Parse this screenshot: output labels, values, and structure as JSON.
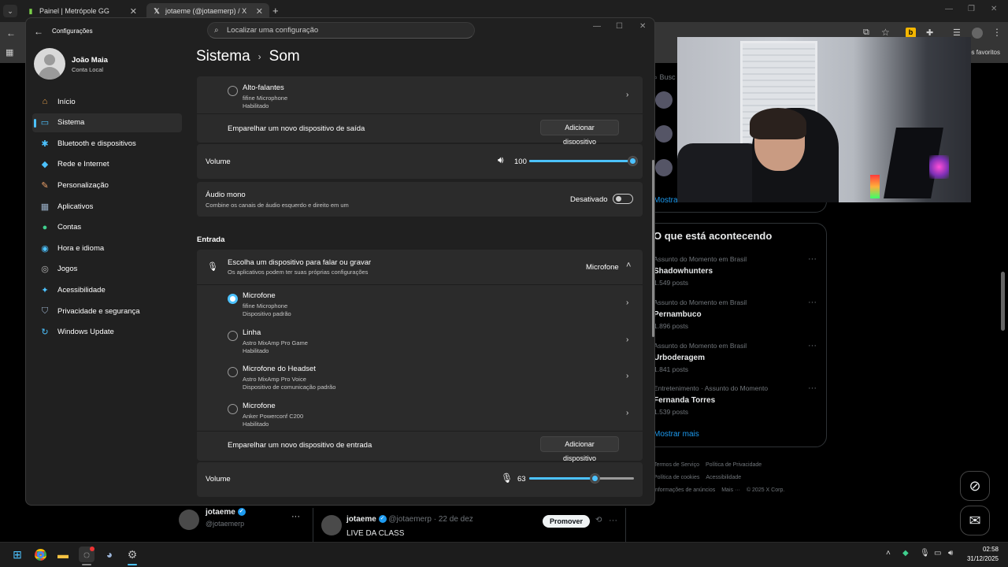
{
  "browser": {
    "tabs": [
      {
        "label": "Painel | Metrópole GG",
        "active": false
      },
      {
        "label": "jotaeme (@jotaemerp) / X",
        "active": true
      }
    ],
    "favorites_label": "os favoritos"
  },
  "x_page": {
    "search_placeholder": "Busc",
    "show_more_top": "Mostrar mais",
    "trends_title": "O que está acontecendo",
    "trends": [
      {
        "category": "Assunto do Momento em Brasil",
        "name": "Shadowhunters",
        "posts": "1.549 posts"
      },
      {
        "category": "Assunto do Momento em Brasil",
        "name": "Pernambuco",
        "posts": "1.896 posts"
      },
      {
        "category": "Assunto do Momento em Brasil",
        "name": "Urboderagem",
        "posts": "1.841 posts"
      },
      {
        "category": "Entretenimento · Assunto do Momento",
        "name": "Fernanda Torres",
        "posts": "1.539 posts"
      }
    ],
    "show_more": "Mostrar mais",
    "footer": [
      "Termos de Serviço",
      "Política de Privacidade",
      "Política de cookies",
      "Acessibilidade",
      "Informações de anúncios",
      "Mais ···",
      "© 2025 X Corp."
    ],
    "profile_card": {
      "name": "jotaeme",
      "handle": "@jotaemerp"
    },
    "tweet": {
      "name": "jotaeme",
      "handle": "@jotaemerp",
      "date": "· 22 de dez",
      "text": "LIVE DA CLASS",
      "promote": "Promover"
    }
  },
  "settings": {
    "title": "Configurações",
    "search_placeholder": "Localizar uma configuração",
    "user": {
      "name": "João Maia",
      "account": "Conta Local"
    },
    "nav": [
      {
        "label": "Início",
        "icon": "home-icon",
        "glyph": "⌂",
        "color": "#e8a04a"
      },
      {
        "label": "Sistema",
        "icon": "system-icon",
        "glyph": "▭",
        "color": "#4cc2ff",
        "active": true
      },
      {
        "label": "Bluetooth e dispositivos",
        "icon": "bluetooth-icon",
        "glyph": "✱",
        "color": "#4cc2ff"
      },
      {
        "label": "Rede e Internet",
        "icon": "wifi-icon",
        "glyph": "◆",
        "color": "#4cc2ff"
      },
      {
        "label": "Personalização",
        "icon": "brush-icon",
        "glyph": "✎",
        "color": "#f0a36a"
      },
      {
        "label": "Aplicativos",
        "icon": "apps-icon",
        "glyph": "▦",
        "color": "#9ab0c8"
      },
      {
        "label": "Contas",
        "icon": "accounts-icon",
        "glyph": "●",
        "color": "#3fcf8e"
      },
      {
        "label": "Hora e idioma",
        "icon": "globe-icon",
        "glyph": "◉",
        "color": "#4cc2ff"
      },
      {
        "label": "Jogos",
        "icon": "gamepad-icon",
        "glyph": "◎",
        "color": "#b8b8b8"
      },
      {
        "label": "Acessibilidade",
        "icon": "accessibility-icon",
        "glyph": "✦",
        "color": "#4cc2ff"
      },
      {
        "label": "Privacidade e segurança",
        "icon": "shield-icon",
        "glyph": "⛉",
        "color": "#9ab0c8"
      },
      {
        "label": "Windows Update",
        "icon": "update-icon",
        "glyph": "↻",
        "color": "#4cc2ff"
      }
    ],
    "breadcrumb": {
      "parent": "Sistema",
      "current": "Som"
    },
    "output": {
      "speaker": {
        "name": "Alto-falantes",
        "device": "fifine  Microphone",
        "status": "Habilitado"
      },
      "pair_label": "Emparelhar um novo dispositivo de saída",
      "pair_button": "Adicionar dispositivo",
      "volume_label": "Volume",
      "volume_value": "100",
      "volume_level": 1.0,
      "mono_title": "Áudio mono",
      "mono_sub": "Combine os canais de áudio esquerdo e direito em um",
      "mono_state": "Desativado"
    },
    "input": {
      "section": "Entrada",
      "choose_title": "Escolha um dispositivo para falar ou gravar",
      "choose_sub": "Os aplicativos podem ter suas próprias configurações",
      "choose_value": "Microfone",
      "devices": [
        {
          "name": "Microfone",
          "device": "fifine  Microphone",
          "status": "Dispositivo padrão",
          "selected": true
        },
        {
          "name": "Linha",
          "device": "Astro MixAmp Pro Game",
          "status": "Habilitado",
          "selected": false
        },
        {
          "name": "Microfone do Headset",
          "device": "Astro MixAmp Pro Voice",
          "status": "Dispositivo de comunicação padrão",
          "selected": false
        },
        {
          "name": "Microfone",
          "device": "Anker Powerconf C200",
          "status": "Habilitado",
          "selected": false
        }
      ],
      "pair_label": "Emparelhar um novo dispositivo de entrada",
      "pair_button": "Adicionar dispositivo",
      "volume_label": "Volume",
      "volume_value": "63",
      "volume_level": 0.63
    }
  },
  "taskbar": {
    "time": "02:58",
    "date": "31/12/2025"
  }
}
